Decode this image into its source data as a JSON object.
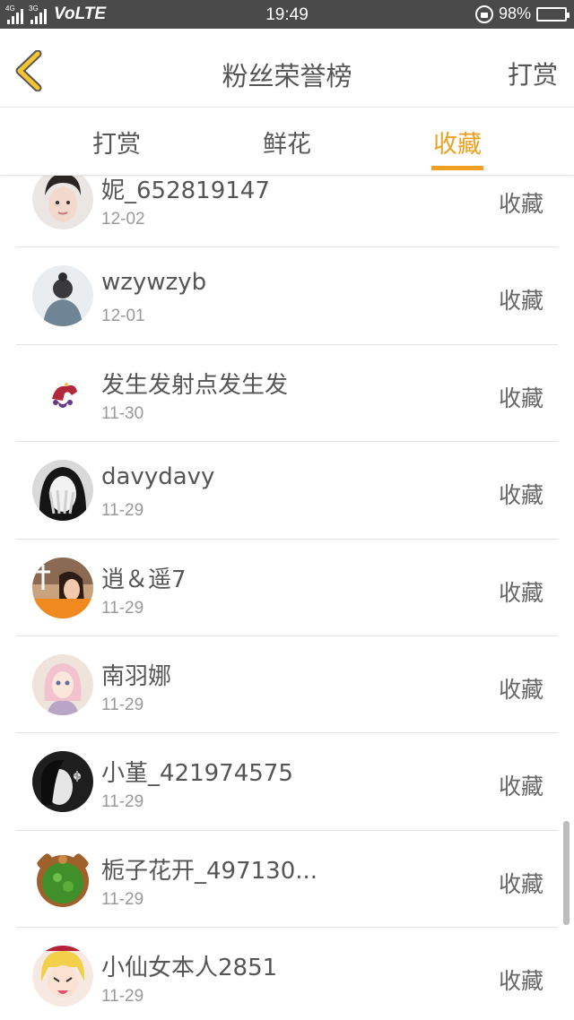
{
  "status_bar": {
    "net1": "4G",
    "net2": "3G",
    "carrier": "VoLTE",
    "time": "19:49",
    "battery_pct": "98%",
    "battery_fill": 0.98
  },
  "header": {
    "title": "粉丝荣誉榜",
    "right_action": "打赏"
  },
  "tabs": [
    {
      "label": "打赏",
      "active": false
    },
    {
      "label": "鲜花",
      "active": false
    },
    {
      "label": "收藏",
      "active": true
    }
  ],
  "colors": {
    "accent": "#f0a020",
    "text": "#555555",
    "muted": "#999999"
  },
  "list": [
    {
      "name": "妮_652819147",
      "date": "12-02",
      "action": "收藏",
      "avatar": "girl-portrait"
    },
    {
      "name": "wzywzyb",
      "date": "12-01",
      "action": "收藏",
      "avatar": "person-back"
    },
    {
      "name": "发生发射点发生发",
      "date": "11-30",
      "action": "收藏",
      "avatar": "jester-hat"
    },
    {
      "name": "davydavy",
      "date": "11-29",
      "action": "收藏",
      "avatar": "face-covered"
    },
    {
      "name": "逍＆遥7",
      "date": "11-29",
      "action": "收藏",
      "avatar": "girl-photo"
    },
    {
      "name": "南羽娜",
      "date": "11-29",
      "action": "收藏",
      "avatar": "doll"
    },
    {
      "name": "小堇_421974575",
      "date": "11-29",
      "action": "收藏",
      "avatar": "dark-portrait"
    },
    {
      "name": "栀子花开_497130...",
      "date": "11-29",
      "action": "收藏",
      "avatar": "bear-frame"
    },
    {
      "name": "小仙女本人2851",
      "date": "11-29",
      "action": "收藏",
      "avatar": "anime-girl"
    }
  ]
}
